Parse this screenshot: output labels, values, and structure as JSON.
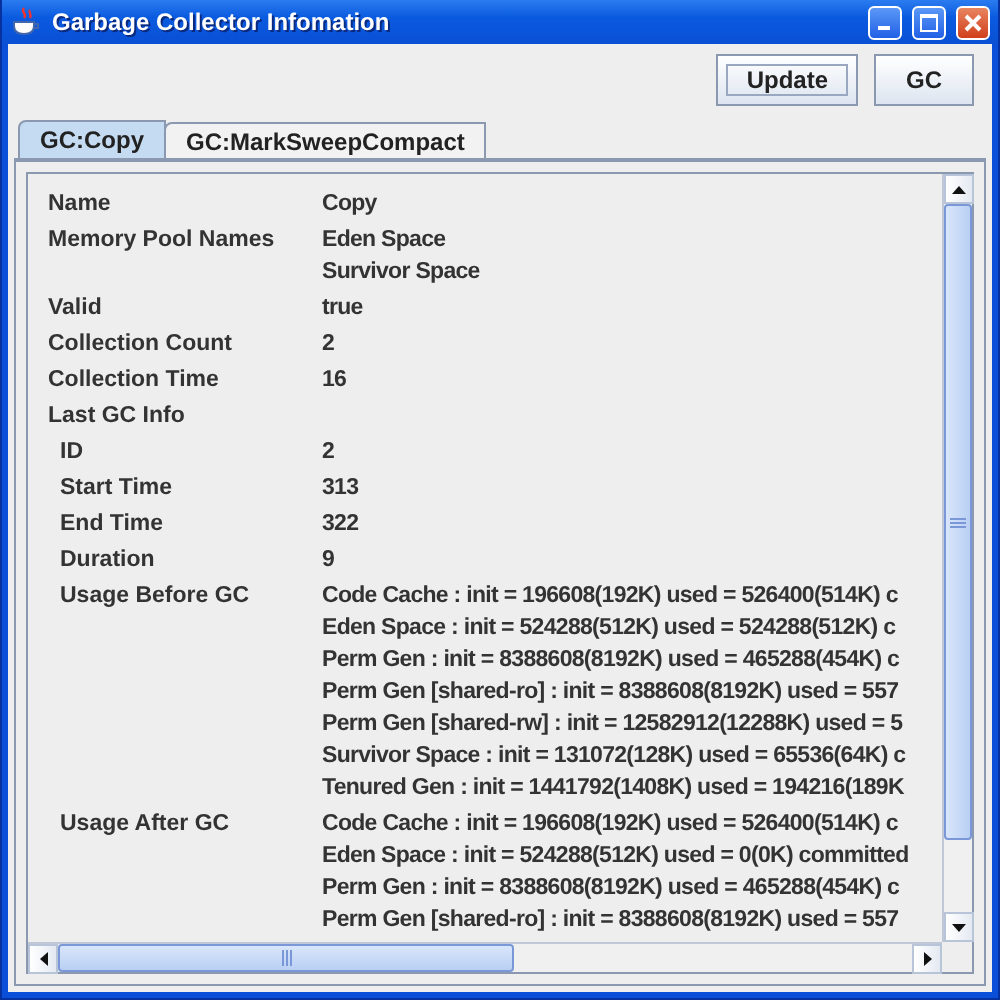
{
  "window": {
    "title": "Garbage Collector Infomation"
  },
  "buttons": [
    {
      "label": "Update",
      "focused": true
    },
    {
      "label": "GC",
      "focused": false
    }
  ],
  "tabs": [
    {
      "label": "GC:Copy",
      "selected": true
    },
    {
      "label": "GC:MarkSweepCompact",
      "selected": false
    }
  ],
  "properties": [
    {
      "name": "Name",
      "values": [
        "Copy"
      ]
    },
    {
      "name": "Memory Pool Names",
      "values": [
        "Eden Space",
        "Survivor Space"
      ]
    },
    {
      "name": "Valid",
      "values": [
        "true"
      ]
    },
    {
      "name": "Collection Count",
      "values": [
        "2"
      ]
    },
    {
      "name": "Collection Time",
      "values": [
        "16"
      ]
    },
    {
      "name": "Last GC Info",
      "children": [
        {
          "name": "ID",
          "values": [
            "2"
          ]
        },
        {
          "name": "Start Time",
          "values": [
            "313"
          ]
        },
        {
          "name": "End Time",
          "values": [
            "322"
          ]
        },
        {
          "name": "Duration",
          "values": [
            "9"
          ]
        },
        {
          "name": "Usage Before GC",
          "values": [
            "Code Cache : init = 196608(192K) used = 526400(514K) c",
            "Eden Space : init = 524288(512K) used = 524288(512K) c",
            "Perm Gen : init = 8388608(8192K) used = 465288(454K) c",
            "Perm Gen [shared-ro] : init = 8388608(8192K) used = 557",
            "Perm Gen [shared-rw] : init = 12582912(12288K) used = 5",
            "Survivor Space : init = 131072(128K) used = 65536(64K) c",
            "Tenured Gen : init = 1441792(1408K) used = 194216(189K"
          ]
        },
        {
          "name": "Usage After GC",
          "values": [
            "Code Cache : init = 196608(192K) used = 526400(514K) c",
            "Eden Space : init = 524288(512K) used = 0(0K) committed",
            "Perm Gen : init = 8388608(8192K) used = 465288(454K) c",
            "Perm Gen [shared-ro] : init = 8388608(8192K) used = 557"
          ]
        }
      ]
    }
  ]
}
